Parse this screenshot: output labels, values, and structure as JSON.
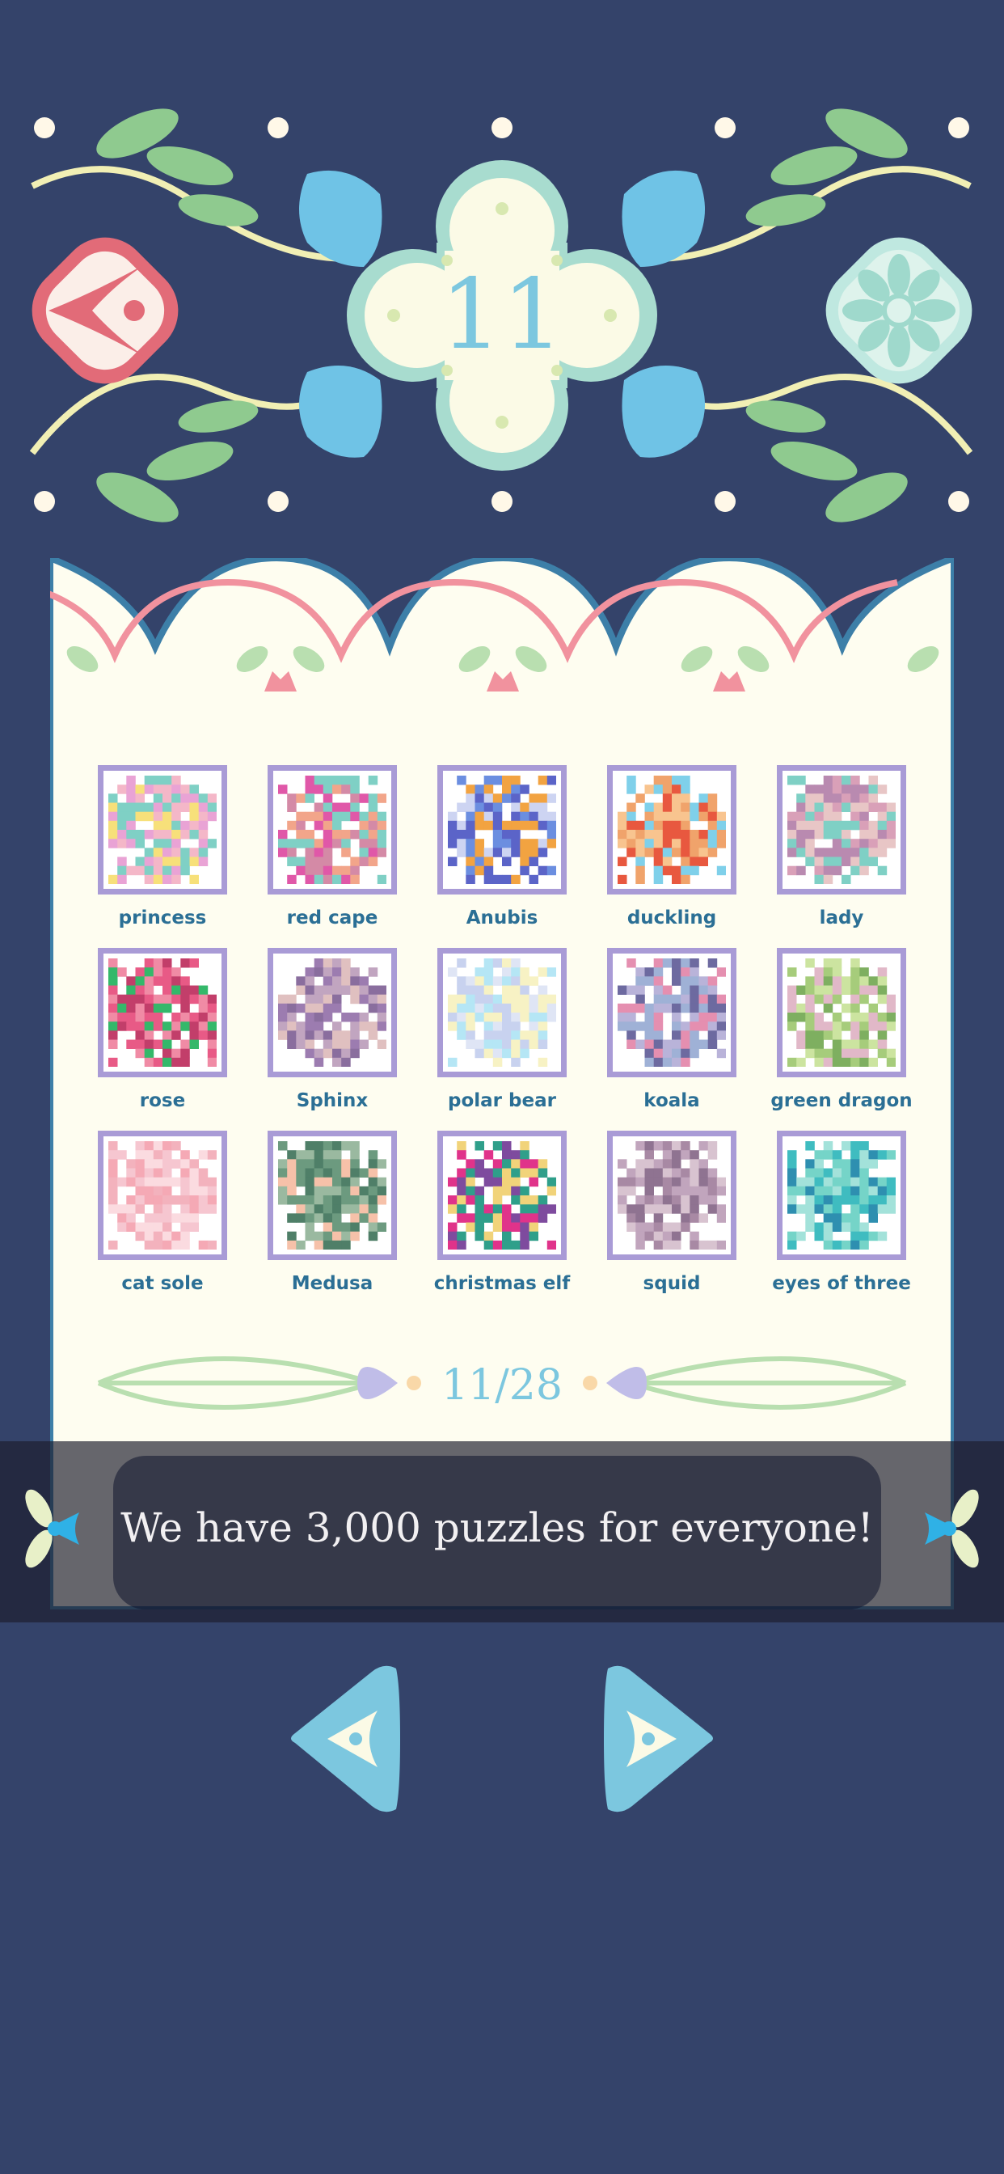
{
  "header": {
    "level": "11",
    "back_icon": "back-arrow-icon",
    "settings_icon": "flower-settings-icon"
  },
  "puzzles": [
    {
      "label": "princess",
      "colors": [
        "#f7e07a",
        "#f4b7c8",
        "#7fd0c5",
        "#e9a3d5"
      ]
    },
    {
      "label": "red cape",
      "colors": [
        "#e058a8",
        "#f2a58a",
        "#7fd0c5",
        "#d48aa6"
      ]
    },
    {
      "label": "Anubis",
      "colors": [
        "#5b64c8",
        "#6b8ee0",
        "#f2a341",
        "#cdd4f2"
      ]
    },
    {
      "label": "duckling",
      "colors": [
        "#f8c48f",
        "#f0a36b",
        "#7fd0ea",
        "#e8583f"
      ]
    },
    {
      "label": "lady",
      "colors": [
        "#d9a0b8",
        "#e8c6c6",
        "#7fd0c5",
        "#b98ab0"
      ]
    },
    {
      "label": "rose",
      "colors": [
        "#e85a86",
        "#f08ba5",
        "#34b86a",
        "#c23e6a"
      ]
    },
    {
      "label": "Sphinx",
      "colors": [
        "#9c7cb0",
        "#c1a5c0",
        "#e0c0c0",
        "#8a6e9e"
      ]
    },
    {
      "label": "polar bear",
      "colors": [
        "#dfe5f5",
        "#c8d2ef",
        "#b5e6f5",
        "#f7f2c4"
      ]
    },
    {
      "label": "koala",
      "colors": [
        "#b9b3d9",
        "#9fb1d6",
        "#e58fb0",
        "#6d6aa0"
      ]
    },
    {
      "label": "green dragon",
      "colors": [
        "#a6cc7b",
        "#cce4a0",
        "#e1b8c8",
        "#7eaf60"
      ]
    },
    {
      "label": "cat sole",
      "colors": [
        "#f6c6d0",
        "#f3b2bd",
        "#fbdbe0",
        "#f5a9b5"
      ]
    },
    {
      "label": "Medusa",
      "colors": [
        "#6c9a7f",
        "#f6c1a9",
        "#4f7f68",
        "#9ab9a0"
      ]
    },
    {
      "label": "christmas elf",
      "colors": [
        "#e0338a",
        "#2f9f8a",
        "#f1d37a",
        "#7e4b9e"
      ]
    },
    {
      "label": "squid",
      "colors": [
        "#c1a5bd",
        "#a889a4",
        "#d8c3d0",
        "#8f7391"
      ]
    },
    {
      "label": "eyes of three",
      "colors": [
        "#3fbcc0",
        "#2e8fb0",
        "#75d4c8",
        "#a3e2da"
      ]
    }
  ],
  "page": {
    "indicator": "11/28",
    "current": 11,
    "total": 28
  },
  "banner": {
    "text": "We have 3,000 puzzles for everyone!"
  },
  "nav": {
    "prev_icon": "prev-page-arrow-icon",
    "next_icon": "next-page-arrow-icon"
  },
  "colors": {
    "background": "#34436a",
    "card": "#fefdf0",
    "accent_blue": "#7cc7df",
    "label": "#2b6f95",
    "tile_border": "#a99bd6",
    "back_button": "#e26b78",
    "settings_button": "#bfe8e0"
  }
}
